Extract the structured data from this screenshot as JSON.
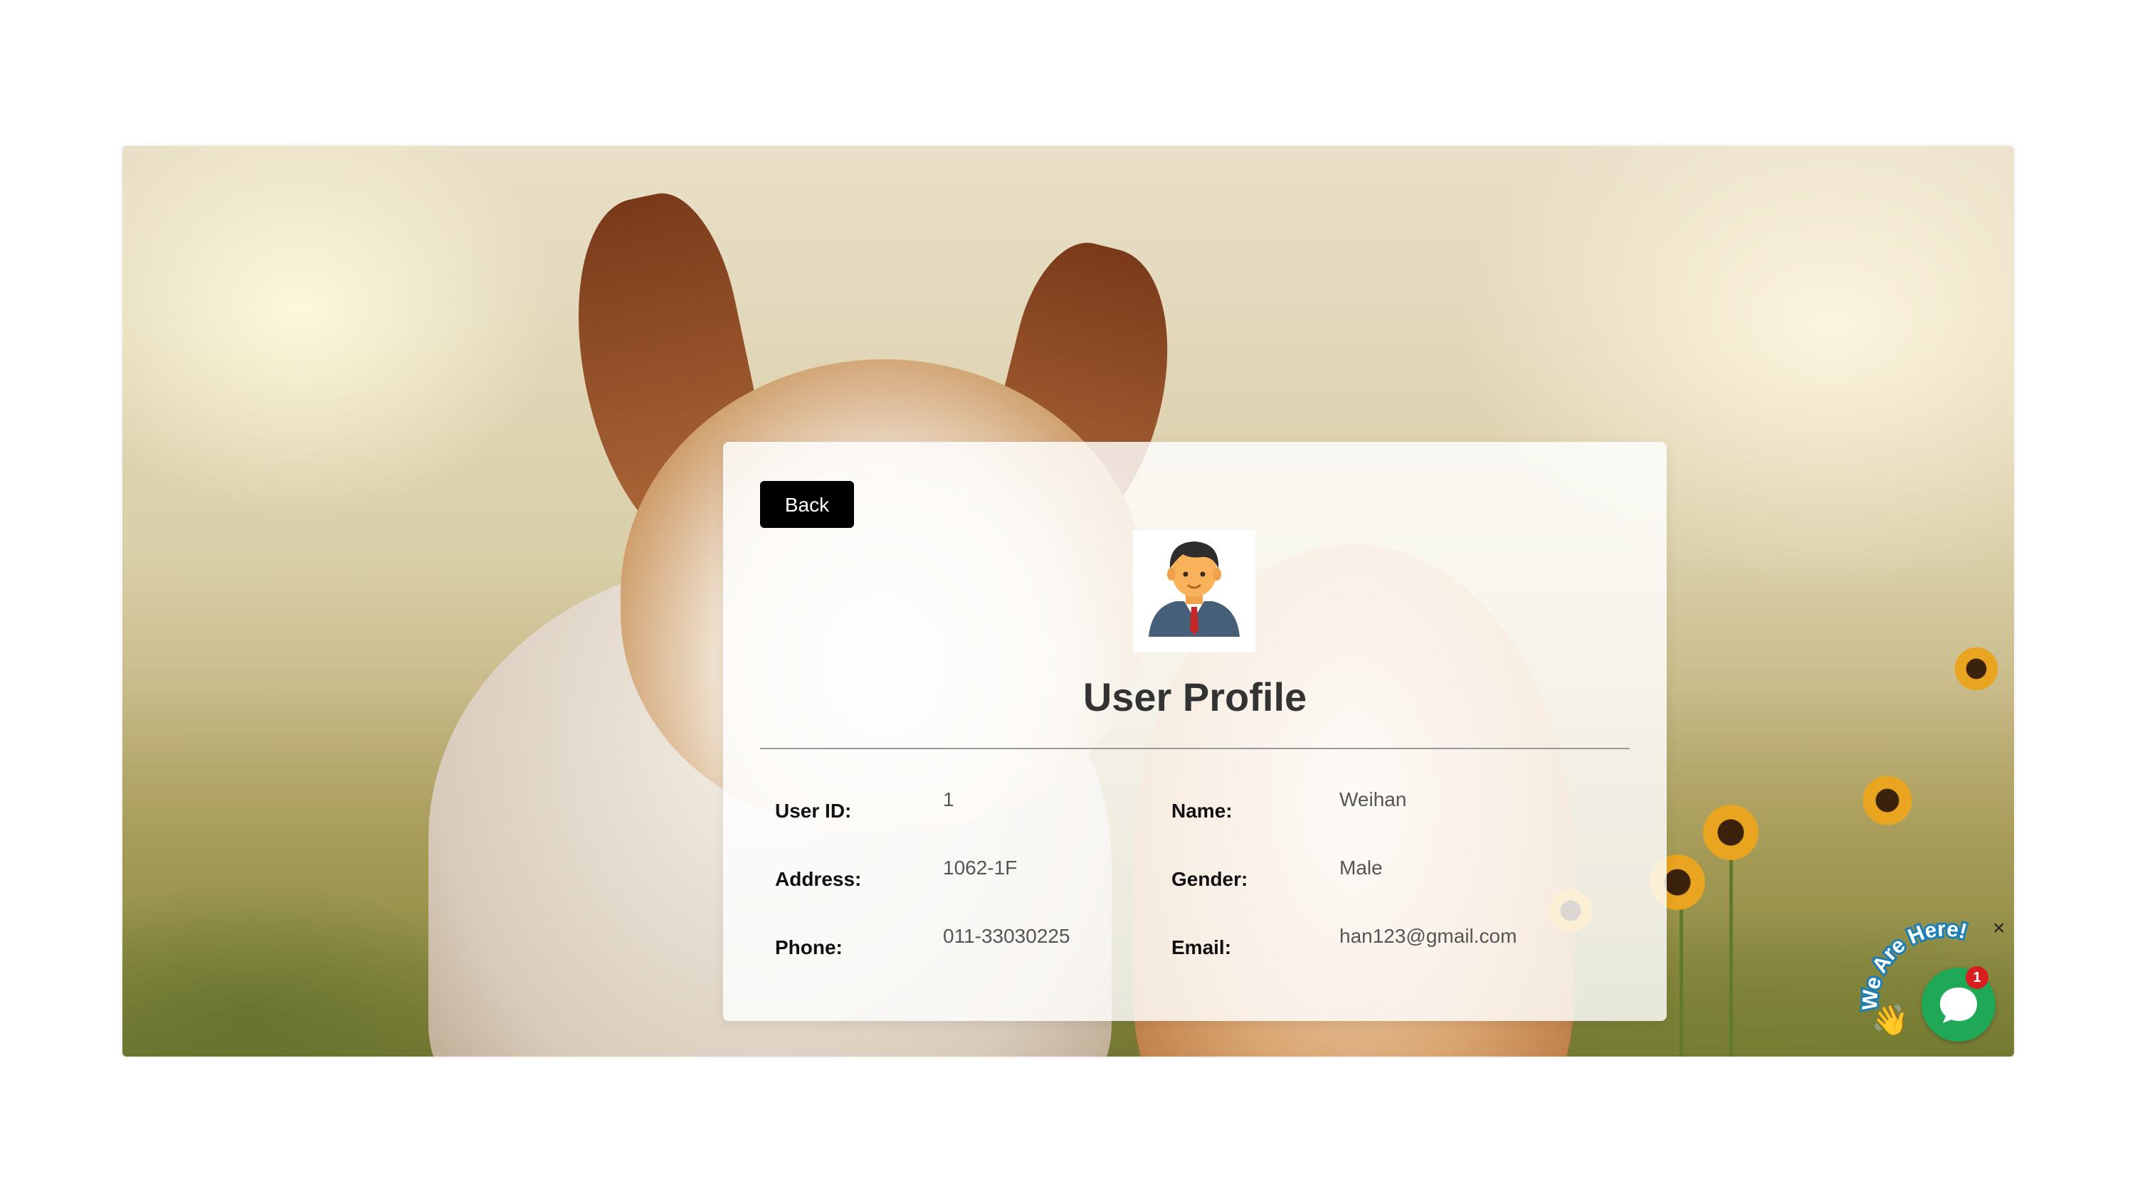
{
  "profile": {
    "back_label": "Back",
    "title": "User Profile",
    "avatar_icon": "businessman-avatar-icon",
    "fields": {
      "user_id": {
        "label": "User ID:",
        "value": "1"
      },
      "name": {
        "label": "Name:",
        "value": "Weihan"
      },
      "address": {
        "label": "Address:",
        "value": "1062-1F"
      },
      "gender": {
        "label": "Gender:",
        "value": "Male"
      },
      "phone": {
        "label": "Phone:",
        "value": "011-33030225"
      },
      "email": {
        "label": "Email:",
        "value": "han123@gmail.com"
      }
    }
  },
  "chat": {
    "banner_text": "We Are Here!",
    "badge_count": "1",
    "close_symbol": "×",
    "hand_icon": "👋",
    "accent_color": "#1fa855",
    "badge_color": "#d81e1e"
  },
  "background": {
    "description_icon": "dog-and-cat-photo-background"
  }
}
